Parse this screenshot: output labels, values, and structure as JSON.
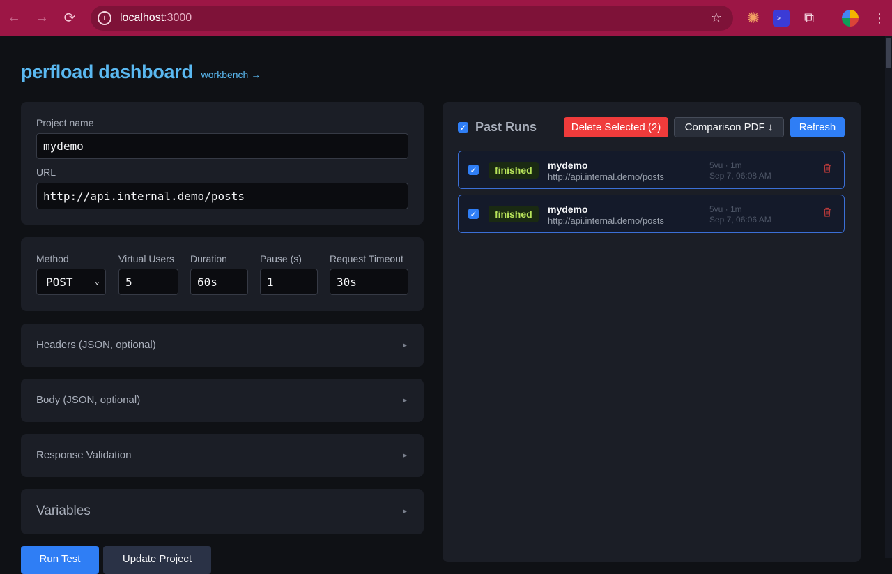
{
  "browser": {
    "url_host": "localhost",
    "url_port": ":3000"
  },
  "header": {
    "title": "perfload dashboard",
    "workbench_link": "workbench →"
  },
  "project": {
    "name_label": "Project name",
    "name_value": "mydemo",
    "url_label": "URL",
    "url_value": "http://api.internal.demo/posts"
  },
  "config": {
    "method_label": "Method",
    "method_value": "POST",
    "vus_label": "Virtual Users",
    "vus_value": "5",
    "duration_label": "Duration",
    "duration_value": "60s",
    "pause_label": "Pause (s)",
    "pause_value": "1",
    "timeout_label": "Request Timeout",
    "timeout_value": "30s"
  },
  "sections": {
    "headers": "Headers (JSON, optional)",
    "body": "Body (JSON, optional)",
    "validation": "Response Validation",
    "variables": "Variables",
    "arrow": "►"
  },
  "actions": {
    "run_test": "Run Test",
    "update_project": "Update Project"
  },
  "past_runs": {
    "title": "Past Runs",
    "delete_selected": "Delete Selected (2)",
    "comparison_pdf": "Comparison PDF ↓",
    "refresh": "Refresh",
    "runs": [
      {
        "status": "finished",
        "name": "mydemo",
        "url": "http://api.internal.demo/posts",
        "meta": "5vu · 1m",
        "date": "Sep 7, 06:08 AM"
      },
      {
        "status": "finished",
        "name": "mydemo",
        "url": "http://api.internal.demo/posts",
        "meta": "5vu · 1m",
        "date": "Sep 7, 06:06 AM"
      }
    ]
  },
  "colors": {
    "accent": "#5ab8f0",
    "primary": "#2f7ef5",
    "danger": "#ef3b3b",
    "success_text": "#b7e35a",
    "chrome": "#9c1645"
  }
}
